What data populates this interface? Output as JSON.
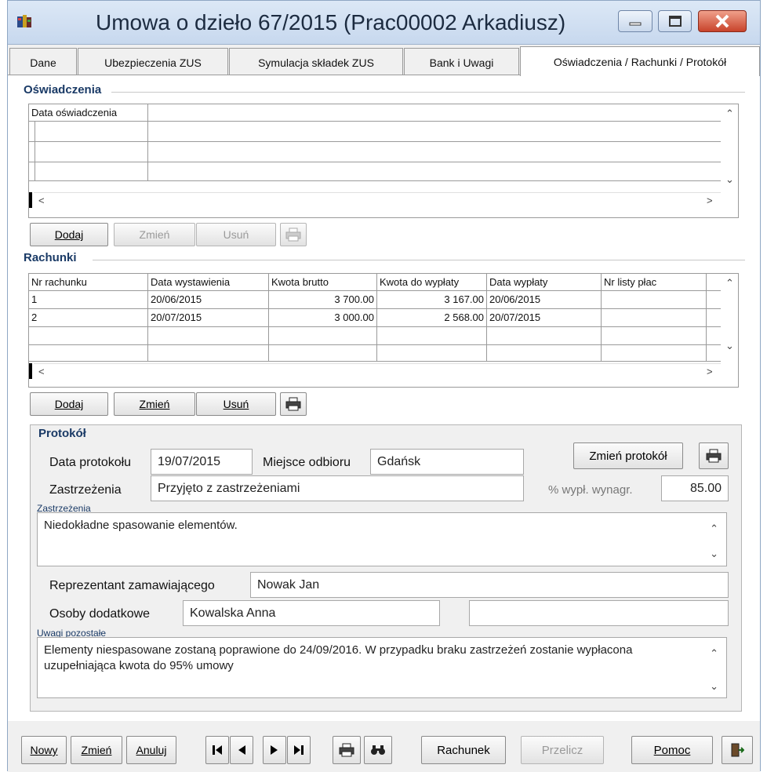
{
  "window": {
    "title": "Umowa o dzieło 67/2015 (Prac00002 Arkadiusz)"
  },
  "tabs": [
    {
      "label": "Dane"
    },
    {
      "label": "Ubezpieczenia ZUS"
    },
    {
      "label": "Symulacja składek ZUS"
    },
    {
      "label": "Bank i Uwagi"
    },
    {
      "label": "Oświadczenia / Rachunki / Protokół"
    }
  ],
  "oswiadczenia": {
    "section_title": "Oświadczenia",
    "columns": [
      "Data oświadczenia"
    ],
    "buttons": {
      "add": "Dodaj",
      "edit": "Zmień",
      "delete": "Usuń"
    }
  },
  "rachunki": {
    "section_title": "Rachunki",
    "columns": [
      "Nr rachunku",
      "Data wystawienia",
      "Kwota brutto",
      "Kwota do wypłaty",
      "Data wypłaty",
      "Nr listy płac"
    ],
    "rows": [
      [
        "1",
        "20/06/2015",
        "3 700.00",
        "3 167.00",
        "20/06/2015",
        ""
      ],
      [
        "2",
        "20/07/2015",
        "3 000.00",
        "2 568.00",
        "20/07/2015",
        ""
      ]
    ],
    "buttons": {
      "add": "Dodaj",
      "edit": "Zmień",
      "delete": "Usuń"
    }
  },
  "protokol": {
    "section_title": "Protokół",
    "date_label": "Data protokołu",
    "date_value": "19/07/2015",
    "place_label": "Miejsce odbioru",
    "place_value": "Gdańsk",
    "change_button": "Zmień protokół",
    "reservations_label": "Zastrzeżenia",
    "reservations_value": "Przyjęto z zastrzeżeniami",
    "pct_label": "% wypł. wynagr.",
    "pct_value": "85.00",
    "reservations_memo_label": "Zastrzeżenia",
    "reservations_memo": "Niedokładne spasowanie elementów.",
    "client_rep_label": "Reprezentant zamawiającego",
    "client_rep_value": "Nowak Jan",
    "extra_persons_label": "Osoby dodatkowe",
    "extra_person_1": "Kowalska Anna",
    "extra_person_2": "",
    "notes_label": "Uwagi pozostałe",
    "notes": "Elementy niespasowane zostaną poprawione do 24/09/2016. W przypadku braku zastrzeżeń zostanie wypłacona uzupełniająca kwota do 95% umowy"
  },
  "bottom": {
    "new": "Nowy",
    "edit": "Zmień",
    "cancel": "Anuluj",
    "invoice": "Rachunek",
    "recalc": "Przelicz",
    "help": "Pomoc"
  }
}
